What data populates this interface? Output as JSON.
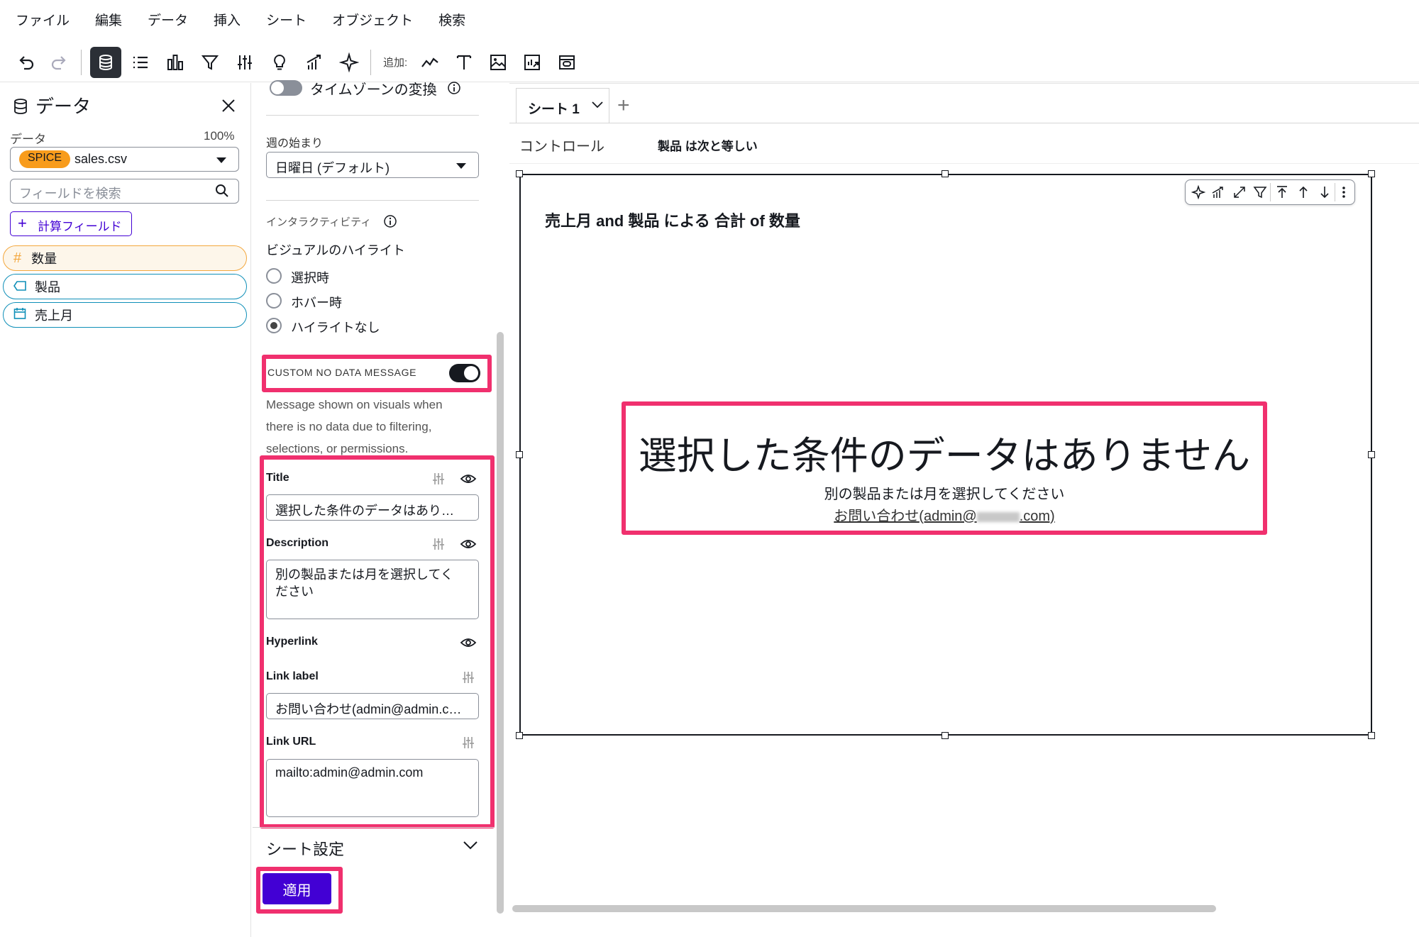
{
  "menu": [
    "ファイル",
    "編集",
    "データ",
    "挿入",
    "シート",
    "オブジェクト",
    "検索"
  ],
  "toolbar": {
    "add_label": "追加:",
    "icons": [
      "undo-icon",
      "redo-icon",
      "dataset-icon",
      "list-icon",
      "visualize-icon",
      "filter-icon",
      "parameters-icon",
      "insights-icon",
      "forecast-icon",
      "sparkle-icon",
      "line-chart-icon",
      "text-icon",
      "image-icon",
      "custom-visual-icon",
      "embed-icon"
    ]
  },
  "left": {
    "title": "データ",
    "data_label": "データ",
    "data_pct": "100%",
    "spice": "SPICE",
    "dataset": "sales.csv",
    "search_placeholder": "フィールドを検索",
    "calc_button": "計算フィールド",
    "fields": [
      {
        "label": "数量",
        "type": "measure",
        "color": "#f3a73d"
      },
      {
        "label": "製品",
        "type": "dimension",
        "color": "#0f8fb8"
      },
      {
        "label": "売上月",
        "type": "date",
        "color": "#0f8fb8"
      }
    ]
  },
  "mid": {
    "timezone_label": "タイムゾーンの変換",
    "week_start_label": "週の始まり",
    "week_start_value": "日曜日 (デフォルト)",
    "interactivity_label": "インタラクティビティ",
    "visual_highlight_label": "ビジュアルのハイライト",
    "radios": [
      {
        "label": "選択時",
        "selected": false
      },
      {
        "label": "ホバー時",
        "selected": false
      },
      {
        "label": "ハイライトなし",
        "selected": true
      }
    ],
    "custom_no_data_label": "CUSTOM NO DATA MESSAGE",
    "custom_no_data_on": true,
    "desc_line1": "Message shown on visuals when",
    "desc_line2": "there is no data due to filtering,",
    "desc_line3": "selections, or permissions.",
    "title_label": "Title",
    "title_value": "選択した条件のデータはあり…",
    "description_label": "Description",
    "description_line1": "別の製品または月を選択してく",
    "description_line2": "ださい",
    "hyperlink_label": "Hyperlink",
    "link_label_label": "Link label",
    "link_label_value": "お問い合わせ(admin@admin.c…",
    "link_url_label": "Link URL",
    "link_url_value": "mailto:admin@admin.com",
    "sheet_settings": "シート設定",
    "apply": "適用"
  },
  "sheet": {
    "tab": "シート 1",
    "controls": "コントロール",
    "filter_text": "製品 は次と等しい",
    "visual_title": "売上月 and 製品 による 合計 of 数量",
    "no_data_title": "選択した条件のデータはありません",
    "no_data_desc": "別の製品または月を選択してください",
    "link_part1": "お問い合わせ",
    "link_part2": "(admin@",
    "link_part3": ".com)"
  },
  "colors": {
    "highlight": "#f0306e",
    "accent": "#4200d4",
    "spice": "#f89c1c"
  }
}
